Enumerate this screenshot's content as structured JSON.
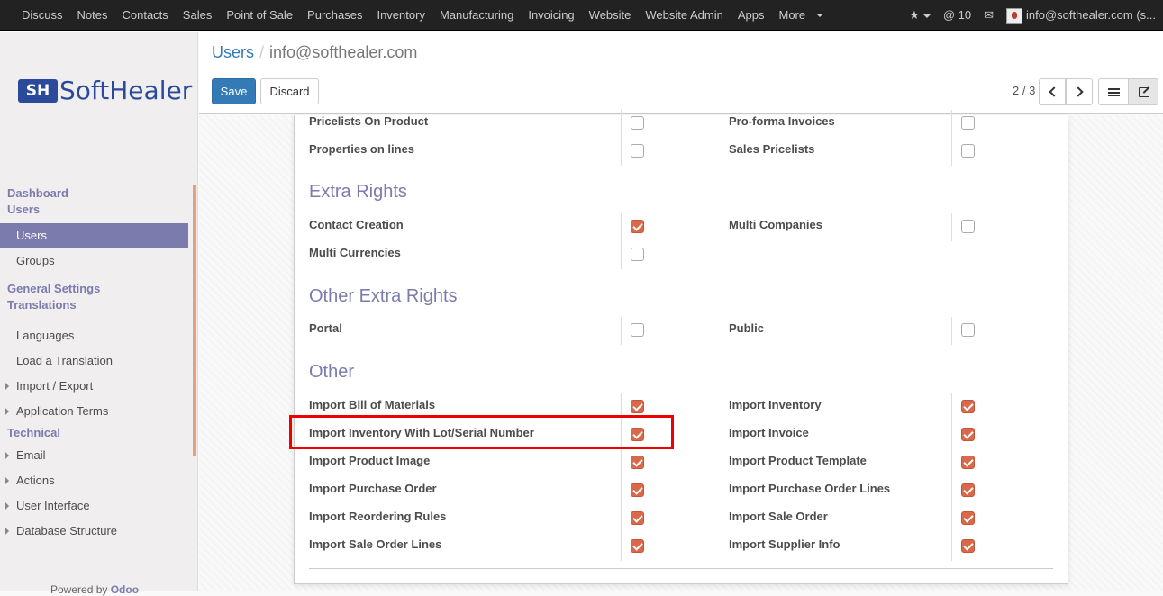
{
  "navbar": {
    "menu": [
      "Discuss",
      "Notes",
      "Contacts",
      "Sales",
      "Point of Sale",
      "Purchases",
      "Inventory",
      "Manufacturing",
      "Invoicing",
      "Website",
      "Website Admin",
      "Apps",
      "More"
    ],
    "notifications": "10",
    "user": "info@softhealer.com (s..."
  },
  "sidebar": {
    "logo_mark": "SH",
    "logo_text": "SoftHealer",
    "sections": [
      {
        "head": "Dashboard",
        "items": []
      },
      {
        "head": "Users",
        "items": [
          {
            "label": "Users",
            "active": true
          },
          {
            "label": "Groups"
          }
        ]
      },
      {
        "head": "General Settings",
        "items": []
      },
      {
        "head": "Translations",
        "items": [
          {
            "label": "Languages"
          },
          {
            "label": "Load a Translation"
          },
          {
            "label": "Import / Export",
            "expandable": true
          },
          {
            "label": "Application Terms",
            "expandable": true
          }
        ]
      },
      {
        "head": "Technical",
        "items": [
          {
            "label": "Email",
            "expandable": true
          },
          {
            "label": "Actions",
            "expandable": true
          },
          {
            "label": "User Interface",
            "expandable": true
          },
          {
            "label": "Database Structure",
            "expandable": true
          }
        ]
      }
    ],
    "powered_by": "Powered by",
    "powered_brand": "Odoo"
  },
  "control": {
    "breadcrumb_root": "Users",
    "breadcrumb_sep": "/",
    "breadcrumb_current": "info@softhealer.com",
    "save_label": "Save",
    "discard_label": "Discard",
    "pager": "2 / 3"
  },
  "form": {
    "top_rows": [
      {
        "left": "Pricelists On Product",
        "left_checked": false,
        "right": "Pro-forma Invoices",
        "right_checked": false
      },
      {
        "left": "Properties on lines",
        "left_checked": false,
        "right": "Sales Pricelists",
        "right_checked": false
      }
    ],
    "sections": [
      {
        "title": "Extra Rights",
        "rows": [
          {
            "left": "Contact Creation",
            "left_checked": true,
            "right": "Multi Companies",
            "right_checked": false
          },
          {
            "left": "Multi Currencies",
            "left_checked": false,
            "right": null
          }
        ]
      },
      {
        "title": "Other Extra Rights",
        "rows": [
          {
            "left": "Portal",
            "left_checked": false,
            "right": "Public",
            "right_checked": false
          }
        ]
      },
      {
        "title": "Other",
        "rows": [
          {
            "left": "Import Bill of Materials",
            "left_checked": true,
            "right": "Import Inventory",
            "right_checked": true
          },
          {
            "left": "Import Inventory With Lot/Serial Number",
            "left_checked": true,
            "right": "Import Invoice",
            "right_checked": true,
            "highlighted": true
          },
          {
            "left": "Import Product Image",
            "left_checked": true,
            "right": "Import Product Template",
            "right_checked": true
          },
          {
            "left": "Import Purchase Order",
            "left_checked": true,
            "right": "Import Purchase Order Lines",
            "right_checked": true
          },
          {
            "left": "Import Reordering Rules",
            "left_checked": true,
            "right": "Import Sale Order",
            "right_checked": true
          },
          {
            "left": "Import Sale Order Lines",
            "left_checked": true,
            "right": "Import Supplier Info",
            "right_checked": true
          }
        ]
      }
    ]
  }
}
